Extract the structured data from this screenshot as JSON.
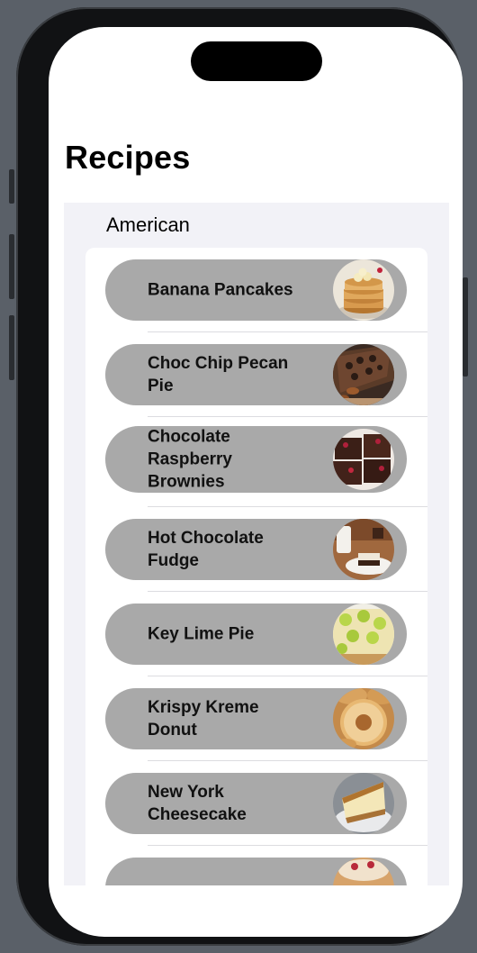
{
  "page_title": "Recipes",
  "section": {
    "header": "American"
  },
  "recipes": [
    {
      "name": "Banana Pancakes",
      "photo": "banana-pancakes-photo"
    },
    {
      "name": "Choc Chip Pecan Pie",
      "photo": "pecan-pie-photo"
    },
    {
      "name": "Chocolate Raspberry Brownies",
      "photo": "brownies-photo"
    },
    {
      "name": "Hot Chocolate Fudge",
      "photo": "fudge-photo"
    },
    {
      "name": "Key Lime Pie",
      "photo": "key-lime-pie-photo"
    },
    {
      "name": "Krispy Kreme Donut",
      "photo": "donut-photo"
    },
    {
      "name": "New York Cheesecake",
      "photo": "cheesecake-photo"
    },
    {
      "name": "",
      "photo": "partial-recipe-photo"
    }
  ],
  "colors": {
    "device_background": "#5a6068",
    "list_background": "#f2f2f7",
    "row_pill": "#a9a9a9",
    "text": "#111111"
  }
}
